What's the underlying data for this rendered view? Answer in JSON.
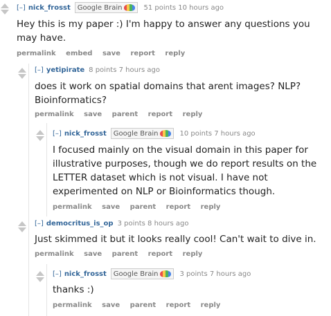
{
  "comments": [
    {
      "expand": "[–]",
      "author": "nick_frosst",
      "flair": "Google Brain",
      "meta": "51 points 10 hours ago",
      "body": "Hey this is my paper :) I'm happy to answer any questions you may have.",
      "buttons": [
        "permalink",
        "embed",
        "save",
        "report",
        "reply"
      ]
    },
    {
      "expand": "[–]",
      "author": "yetipirate",
      "meta": "8 points 7 hours ago",
      "body": "does it work on spatial domains that arent images? NLP? Bioinformatics?",
      "buttons": [
        "permalink",
        "save",
        "parent",
        "report",
        "reply"
      ]
    },
    {
      "expand": "[–]",
      "author": "nick_frosst",
      "flair": "Google Brain",
      "meta": "10 points 7 hours ago",
      "body": "I focused mainly on the visual domain in this paper for illustrative purposes, though we do report results on the LETTER dataset which is not visual. I have not experimented on NLP or Bioinformatics though.",
      "buttons": [
        "permalink",
        "save",
        "parent",
        "report",
        "reply"
      ]
    },
    {
      "expand": "[–]",
      "author": "democritus_is_op",
      "meta": "3 points 8 hours ago",
      "body": "Just skimmed it but it looks really cool! Can't wait to dive in.",
      "buttons": [
        "permalink",
        "save",
        "parent",
        "report",
        "reply"
      ]
    },
    {
      "expand": "[–]",
      "author": "nick_frosst",
      "flair": "Google Brain",
      "meta": "3 points 7 hours ago",
      "body": "thanks :)",
      "buttons": [
        "permalink",
        "save",
        "parent",
        "report",
        "reply"
      ]
    }
  ]
}
